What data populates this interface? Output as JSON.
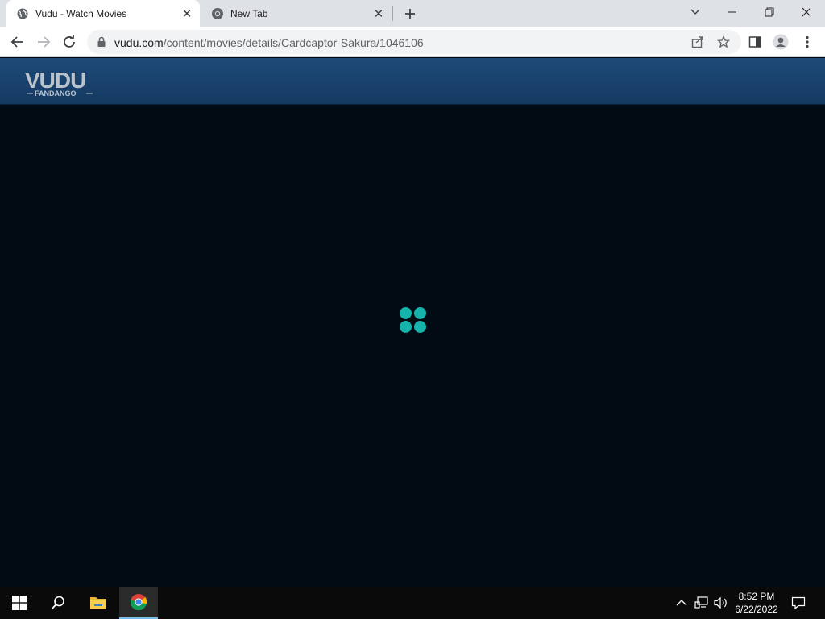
{
  "browser": {
    "tabs": [
      {
        "title": "Vudu - Watch Movies",
        "favicon": "globe-icon",
        "active": true
      },
      {
        "title": "New Tab",
        "favicon": "chrome-icon",
        "active": false
      }
    ],
    "url_domain": "vudu.com",
    "url_path": "/content/movies/details/Cardcaptor-Sakura/1046106"
  },
  "page": {
    "logo_text": "VUDU",
    "logo_subtext": "FANDANGO",
    "header_color": "#1a4270",
    "spinner_color": "#16b3ad",
    "background_color": "#020b14"
  },
  "taskbar": {
    "time": "8:52 PM",
    "date": "6/22/2022",
    "pinned": [
      "windows-start-icon",
      "search-icon",
      "file-explorer-icon",
      "chrome-icon"
    ]
  }
}
